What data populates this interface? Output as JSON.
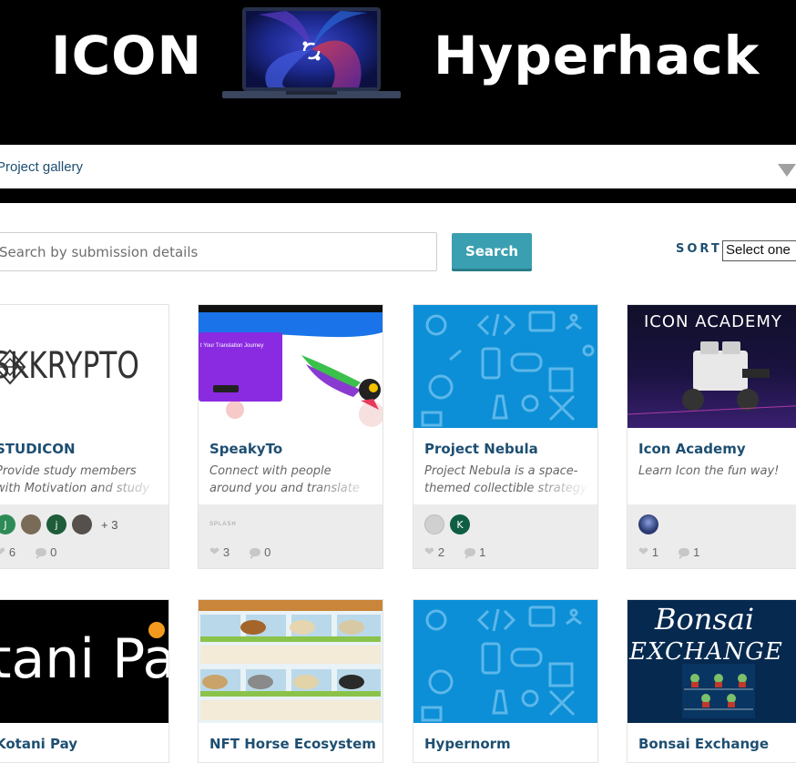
{
  "banner": {
    "left_word": "ICON",
    "right_word": "Hyperhack",
    "logo_icon": "icon-logo-icon"
  },
  "nav": {
    "label": "Project gallery",
    "caret_icon": "triangle-down-icon"
  },
  "search": {
    "placeholder": "Search by submission details",
    "button_label": "Search"
  },
  "sort": {
    "label": "SORT",
    "selected": "Select one"
  },
  "colors": {
    "accent": "#3a9fb0",
    "title": "#1e4f72",
    "banner_bg": "#000000",
    "tile_blue": "#0c8fd6"
  },
  "cards": [
    {
      "title": "STUDICON",
      "description": "Provide study members with Motivation and study",
      "thumb_text": "SKKRYPTO",
      "members": [
        {
          "initial": "J",
          "color": "#2e8b57"
        },
        {
          "initial": "",
          "color": "#7a6a58"
        },
        {
          "initial": "j",
          "color": "#1f5c3a"
        },
        {
          "initial": "",
          "color": "#55504c"
        }
      ],
      "more": "+ 3",
      "likes": "6",
      "comments": "0"
    },
    {
      "title": "SpeakyTo",
      "description": "Connect with people around you and translate",
      "thumb_text": "t Your Translation Journey",
      "members": [],
      "member_caption": "SPLASH",
      "more": "",
      "likes": "3",
      "comments": "0"
    },
    {
      "title": "Project Nebula",
      "description": "Project Nebula is a space-themed collectible strategy",
      "members": [
        {
          "initial": "",
          "color": "#d0d0d0"
        },
        {
          "initial": "K",
          "color": "#0f5e43"
        }
      ],
      "more": "",
      "likes": "2",
      "comments": "1"
    },
    {
      "title": "Icon Academy",
      "description": "Learn Icon the fun way!",
      "thumb_text": "ICON ACADEMY",
      "members": [
        {
          "initial": "",
          "color": "#2a3a72"
        }
      ],
      "more": "",
      "likes": "1",
      "comments": "1"
    },
    {
      "title": "Kotani Pay",
      "thumb_text": "tani Pa"
    },
    {
      "title": "NFT Horse Ecosystem"
    },
    {
      "title": "Hypernorm"
    },
    {
      "title": "Bonsai Exchange",
      "thumb_text": "Bonsai",
      "thumb_text_2": "EXCHANGE"
    }
  ]
}
